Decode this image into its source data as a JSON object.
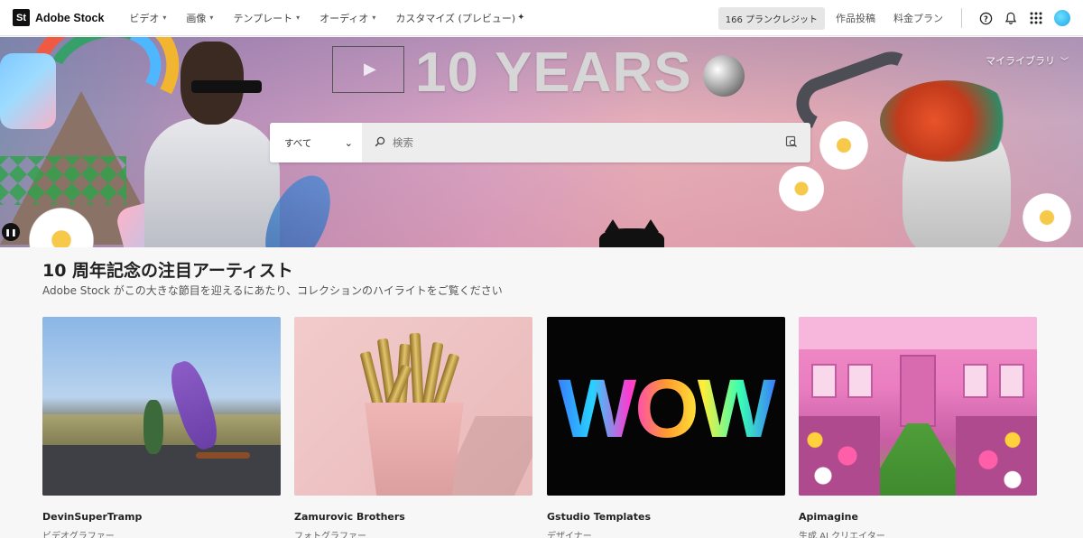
{
  "header": {
    "logo_mark": "St",
    "logo_text": "Adobe Stock",
    "nav": [
      {
        "label": "ビデオ",
        "has_dropdown": true
      },
      {
        "label": "画像",
        "has_dropdown": true
      },
      {
        "label": "テンプレート",
        "has_dropdown": true
      },
      {
        "label": "オーディオ",
        "has_dropdown": true
      },
      {
        "label": "カスタマイズ (プレビュー)",
        "has_dropdown": false
      }
    ],
    "customize_icon": "sparkle-icon",
    "credits_label": "166 プランクレジット",
    "submit_label": "作品投稿",
    "pricing_label": "料金プラン",
    "icons": [
      "help-icon",
      "bell-icon",
      "app-grid-icon",
      "avatar"
    ]
  },
  "hero": {
    "banner_text": "10 YEARS",
    "my_library_label": "マイライブラリ",
    "pause_icon": "pause-icon",
    "search": {
      "category_value": "すべて",
      "placeholder": "検索",
      "search_icon": "magnifier-icon",
      "visual_search_icon": "visual-search-icon"
    }
  },
  "section": {
    "title": "10 周年記念の注目アーティスト",
    "subtitle": "Adobe Stock がこの大きな節目を迎えるにあたり、コレクションのハイライトをご覧ください"
  },
  "artists": [
    {
      "name": "DevinSuperTramp",
      "role": "ビデオグラファー"
    },
    {
      "name": "Zamurovic Brothers",
      "role": "フォトグラファー"
    },
    {
      "name": "Gstudio Templates",
      "role": "デザイナー"
    },
    {
      "name": "Apimagine",
      "role": "生成 AI クリエイター"
    }
  ],
  "artist_3_image_text": "WOW",
  "colors": {
    "header_bg": "#ffffff",
    "page_bg": "#f7f7f7",
    "avatar": "#1aa6e8",
    "credits_bg": "#e6e6e6"
  }
}
